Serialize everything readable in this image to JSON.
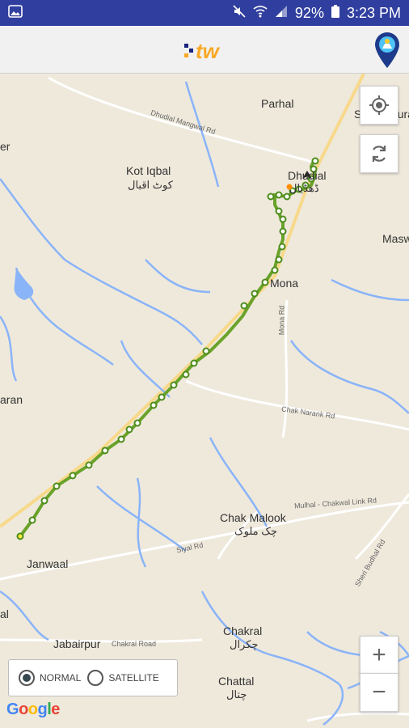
{
  "status_bar": {
    "battery": "92%",
    "time": "3:23 PM"
  },
  "app_bar": {
    "logo_text": "tw"
  },
  "map": {
    "places": {
      "parhal": "Parhal",
      "sang_khura": "Sang Khura",
      "kot_iqbal": "Kot Iqbal",
      "kot_iqbal_ur": "کوٹ اقبال",
      "dhudial": "Dhudial",
      "dhudial_ur": "ڈھڈیال",
      "masw": "Masw",
      "mona": "Mona",
      "chak_malook": "Chak Malook",
      "chak_malook_ur": "چک ملوک",
      "janwaal": "Janwaal",
      "jabairpur": "Jabairpur",
      "chakral": "Chakral",
      "chakral_ur": "چکرال",
      "chattal": "Chattal",
      "chattal_ur": "چتال",
      "left_er": "er",
      "left_aran": "aran",
      "left_al": "al"
    },
    "roads": {
      "dhudial_mangwal": "Dhudial Mangwal Rd",
      "mona_rd": "Mona Rd",
      "chak_narank": "Chak Narank Rd",
      "mulhal_chakwal": "Mulhal - Chakwal Link Rd",
      "siyal": "Siyal Rd",
      "chakral_road": "Chakral Road",
      "sheri_budhal": "Sheri Budhal Rd"
    },
    "map_type": {
      "normal": "NORMAL",
      "satellite": "SATELLITE",
      "selected": "NORMAL"
    },
    "attribution": "Google",
    "zoom_in": "+",
    "zoom_out": "−"
  },
  "colors": {
    "status_bar": "#303f9f",
    "track": "#8bc34a",
    "water": "#8ab4f8",
    "land": "#efe9dc"
  }
}
